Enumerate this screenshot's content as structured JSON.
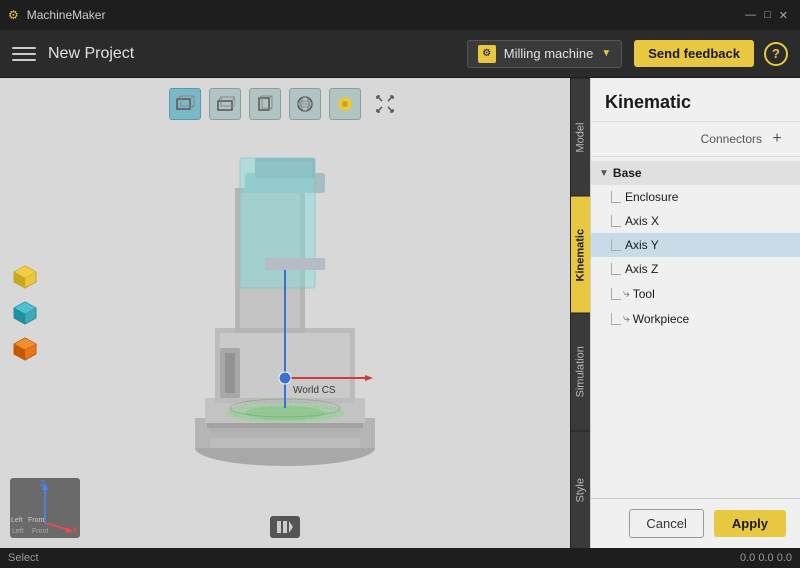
{
  "titlebar": {
    "app_name": "MachineMaker",
    "icon": "⚙",
    "minimize": "—",
    "maximize": "□",
    "close": "✕"
  },
  "header": {
    "menu_label": "menu",
    "project_title": "New Project",
    "machine_icon": "⚙",
    "machine_name": "Milling machine",
    "machine_chevron": "▼",
    "feedback_label": "Send feedback",
    "help_label": "?"
  },
  "viewport": {
    "toolbar_buttons": [
      {
        "id": "front-iso",
        "icon": "◱",
        "active": true
      },
      {
        "id": "top-iso",
        "icon": "◲",
        "active": false
      },
      {
        "id": "side-iso",
        "icon": "◳",
        "active": false
      },
      {
        "id": "perspective",
        "icon": "✦",
        "active": false
      },
      {
        "id": "shading",
        "icon": "◉",
        "active": false
      },
      {
        "id": "scale",
        "icon": "⤢",
        "active": false
      }
    ],
    "world_cs_label": "World CS",
    "play_button": "⏸"
  },
  "left_sidebar": {
    "cubes": [
      {
        "id": "cube-yellow",
        "icon": "🟡"
      },
      {
        "id": "cube-teal",
        "icon": "🔷"
      },
      {
        "id": "cube-orange",
        "icon": "🟠"
      }
    ]
  },
  "right_tabs": {
    "tabs": [
      {
        "id": "model",
        "label": "Model",
        "active": false
      },
      {
        "id": "kinematic",
        "label": "Kinematic",
        "active": true
      },
      {
        "id": "simulation",
        "label": "Simulation",
        "active": false
      },
      {
        "id": "style",
        "label": "Style",
        "active": false
      }
    ]
  },
  "right_panel": {
    "title": "Kinematic",
    "connectors_label": "Connectors",
    "add_icon": "+",
    "tree": {
      "items": [
        {
          "id": "base",
          "label": "Base",
          "type": "group",
          "indent": 0,
          "has_arrow": true,
          "arrow": "▼",
          "icon": ""
        },
        {
          "id": "enclosure",
          "label": "Enclosure",
          "type": "child",
          "indent": 1,
          "has_arrow": false,
          "icon": ""
        },
        {
          "id": "axis-x",
          "label": "Axis X",
          "type": "child",
          "indent": 1,
          "has_arrow": false,
          "icon": ""
        },
        {
          "id": "axis-y",
          "label": "Axis Y",
          "type": "child-highlight",
          "indent": 1,
          "has_arrow": false,
          "icon": ""
        },
        {
          "id": "axis-z",
          "label": "Axis Z",
          "type": "child",
          "indent": 1,
          "has_arrow": false,
          "icon": ""
        },
        {
          "id": "tool",
          "label": "Tool",
          "type": "child-link",
          "indent": 1,
          "has_arrow": false,
          "icon": "⤷"
        },
        {
          "id": "workpiece",
          "label": "Workpiece",
          "type": "child-link",
          "indent": 1,
          "has_arrow": false,
          "icon": "⤷"
        }
      ]
    }
  },
  "bottom_bar": {
    "cancel_label": "Cancel",
    "apply_label": "Apply"
  },
  "status_bar": {
    "select_label": "Select",
    "coords": "0.0 0.0 0.0"
  }
}
